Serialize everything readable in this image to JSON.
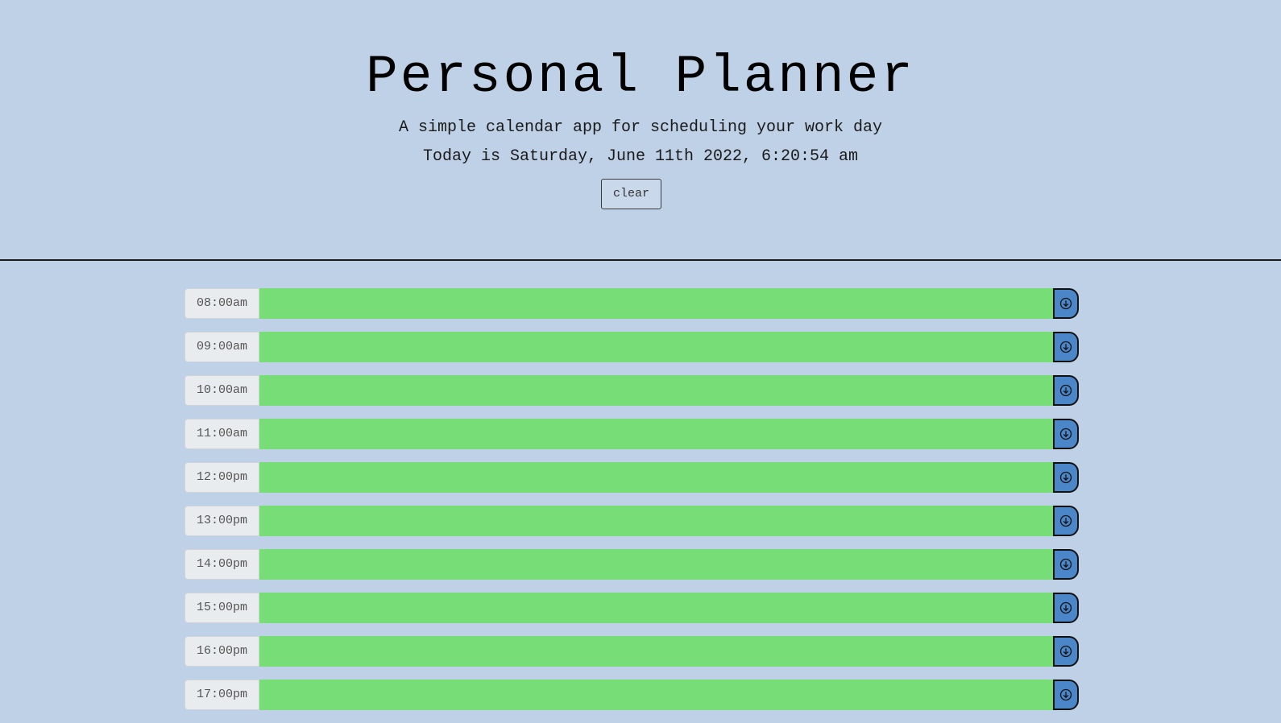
{
  "header": {
    "title": "Personal Planner",
    "subtitle": "A simple calendar app for scheduling your work day",
    "today": "Today is Saturday, June 11th 2022, 6:20:54 am",
    "clear_label": "clear"
  },
  "planner": {
    "rows": [
      {
        "hour": "08:00am",
        "task": ""
      },
      {
        "hour": "09:00am",
        "task": ""
      },
      {
        "hour": "10:00am",
        "task": ""
      },
      {
        "hour": "11:00am",
        "task": ""
      },
      {
        "hour": "12:00pm",
        "task": ""
      },
      {
        "hour": "13:00pm",
        "task": ""
      },
      {
        "hour": "14:00pm",
        "task": ""
      },
      {
        "hour": "15:00pm",
        "task": ""
      },
      {
        "hour": "16:00pm",
        "task": ""
      },
      {
        "hour": "17:00pm",
        "task": ""
      }
    ],
    "save_icon": "arrow-down-circle-icon"
  },
  "colors": {
    "background": "#bfd1e6",
    "future_block": "#77dd77",
    "save_button": "#4a86c8"
  }
}
